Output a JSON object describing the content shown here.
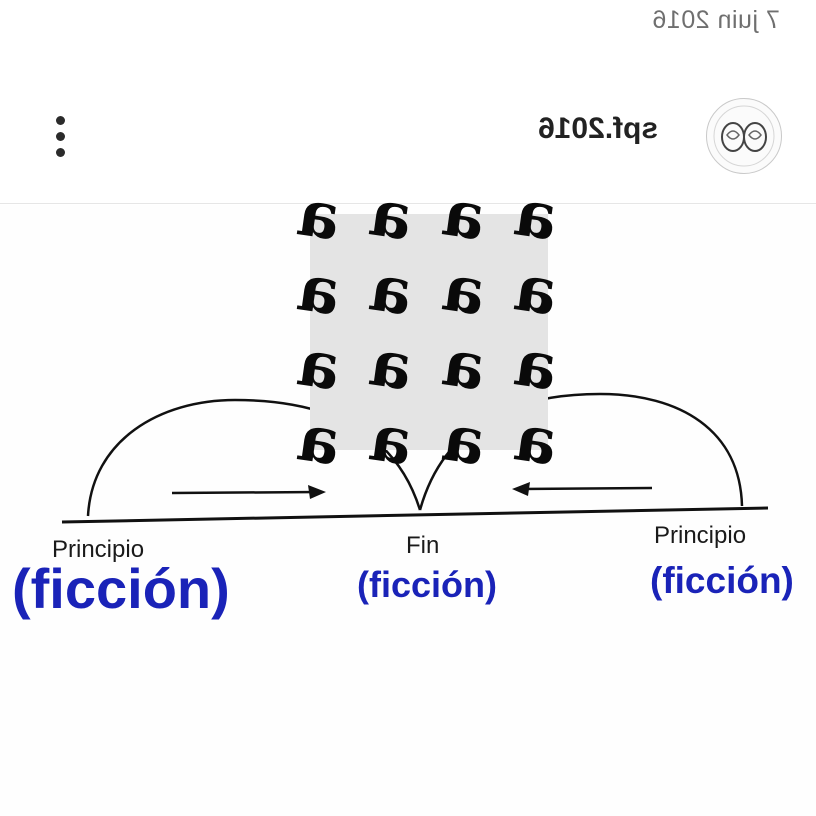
{
  "post_header": {
    "date": "7 juin 2016",
    "username": "spf.2016",
    "avatar_icon": "avatar-circle-icon",
    "more_icon": "more-vertical-icon"
  },
  "diagram": {
    "labels": {
      "left": "Principio",
      "center": "Fin",
      "right": "Principio"
    },
    "annotations": {
      "left": "(ficción)",
      "center": "(ficción)",
      "right": "(ficción)"
    },
    "annotation_color": "#1a23b8",
    "scrambled_glyphs": [
      "a",
      "a",
      "a",
      "a",
      "a",
      "a",
      "a",
      "a",
      "a",
      "a",
      "a",
      "a",
      "a",
      "a",
      "a",
      "a"
    ]
  }
}
